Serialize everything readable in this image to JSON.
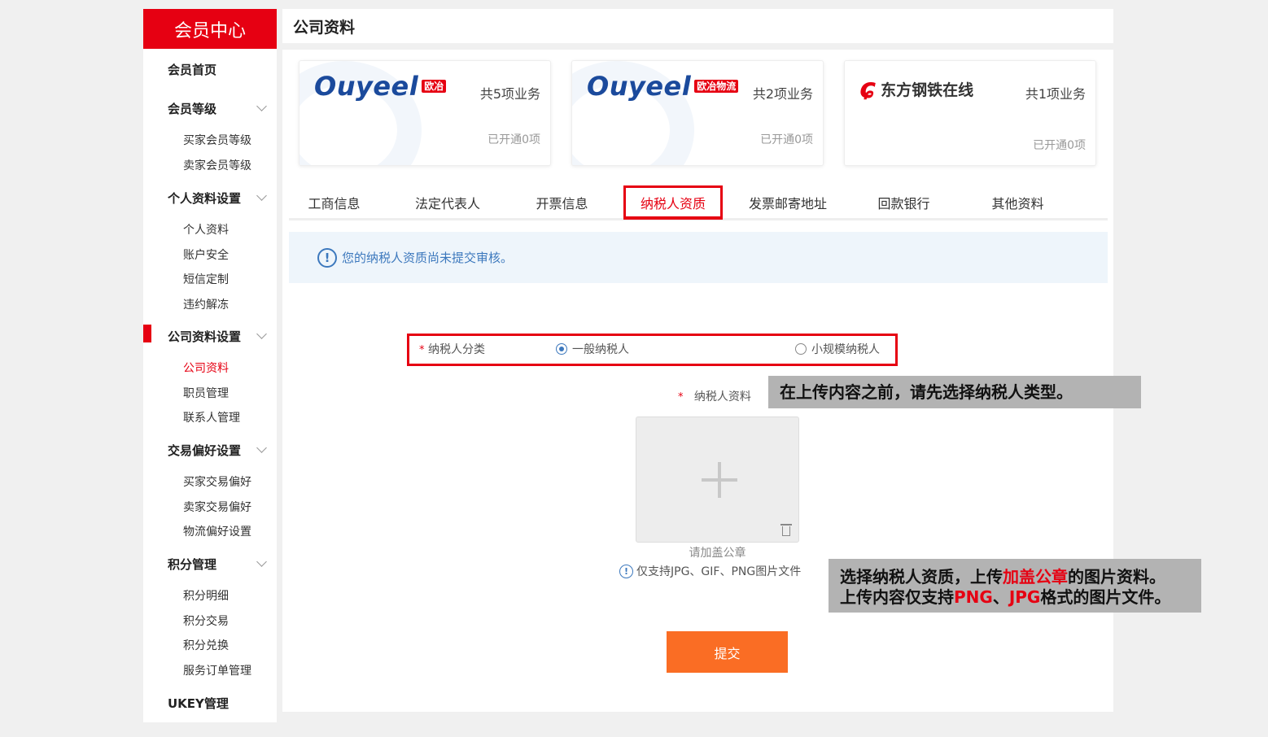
{
  "sidebar": {
    "title": "会员中心",
    "home": "会员首页",
    "groups": [
      {
        "label": "会员等级",
        "items": [
          "买家会员等级",
          "卖家会员等级"
        ]
      },
      {
        "label": "个人资料设置",
        "items": [
          "个人资料",
          "账户安全",
          "短信定制",
          "违约解冻"
        ]
      },
      {
        "label": "公司资料设置",
        "items": [
          "公司资料",
          "职员管理",
          "联系人管理"
        ]
      },
      {
        "label": "交易偏好设置",
        "items": [
          "买家交易偏好",
          "卖家交易偏好",
          "物流偏好设置"
        ]
      },
      {
        "label": "积分管理",
        "items": [
          "积分明细",
          "积分交易",
          "积分兑换",
          "服务订单管理"
        ]
      }
    ],
    "ukey": "UKEY管理"
  },
  "page": {
    "title": "公司资料"
  },
  "cards": [
    {
      "logo": "Ouyeel",
      "badge": "欧冶",
      "count": "共5项业务",
      "opened": "已开通0项"
    },
    {
      "logo": "Ouyeel",
      "badge": "欧冶物流",
      "count": "共2项业务",
      "opened": "已开通0项"
    },
    {
      "logo": "东方钢铁在线",
      "count": "共1项业务",
      "opened": "已开通0项"
    }
  ],
  "tabs": [
    "工商信息",
    "法定代表人",
    "开票信息",
    "纳税人资质",
    "发票邮寄地址",
    "回款银行",
    "其他资料"
  ],
  "notice": "您的纳税人资质尚未提交审核。",
  "form": {
    "required_mark": "*",
    "type_label": "纳税人分类",
    "option_general": "一般纳税人",
    "option_small": "小规模纳税人",
    "file_label": "纳税人资料",
    "upload_hint": "请加盖公章",
    "format_hint": "仅支持JPG、GIF、PNG图片文件",
    "submit": "提交"
  },
  "callouts": {
    "first": "在上传内容之前，请先选择纳税人类型。",
    "second_line1_a": "选择纳税人资质，上传",
    "second_line1_red": "加盖公章",
    "second_line1_b": "的图片资料。",
    "second_line2_a": "上传内容仅支持",
    "second_line2_red1": "PNG",
    "second_line2_sep": "、",
    "second_line2_red2": "JPG",
    "second_line2_b": "格式的图片文件。"
  }
}
